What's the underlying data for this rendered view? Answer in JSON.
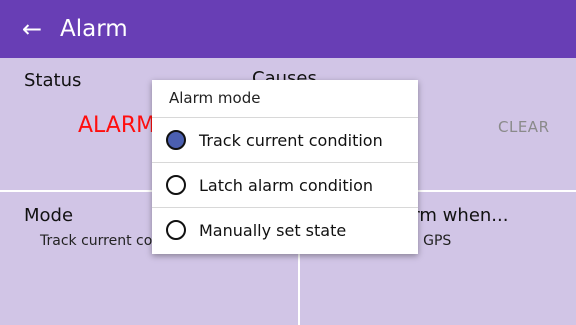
{
  "app_bar": {
    "back_icon": "arrow-left-icon",
    "back_glyph": "←",
    "title": "Alarm",
    "color": "#683eb5"
  },
  "status_card": {
    "status_label": "Status",
    "causes_label": "Causes",
    "status_value": "ALARM",
    "status_color": "#ff0e0e",
    "clear_label": "CLEAR"
  },
  "mode_card": {
    "label": "Mode",
    "value": "Track current condition"
  },
  "alarm_when_card": {
    "label": "Alarm when...",
    "value": "From GPS"
  },
  "dialog": {
    "title": "Alarm mode",
    "options": [
      {
        "label": "Track current condition",
        "selected": true
      },
      {
        "label": "Latch alarm condition",
        "selected": false
      },
      {
        "label": "Manually set state",
        "selected": false
      }
    ]
  }
}
